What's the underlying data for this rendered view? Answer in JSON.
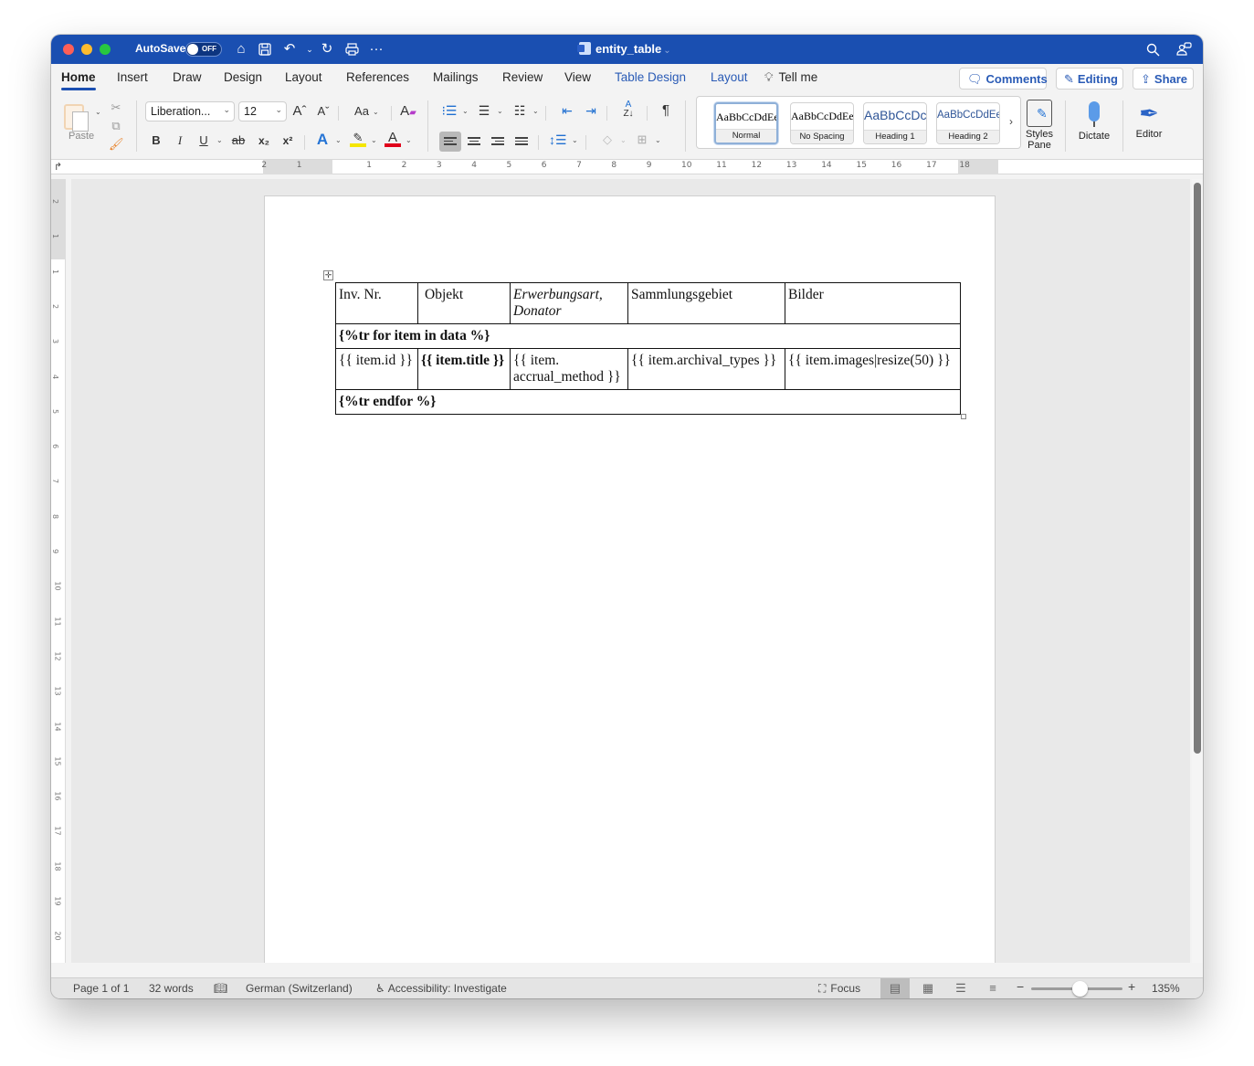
{
  "titlebar": {
    "autosave_label": "AutoSave",
    "autosave_state": "OFF",
    "doc_title": "entity_table",
    "icons": [
      "home-icon",
      "save-icon",
      "undo-icon",
      "redo-icon",
      "print-icon",
      "more-icon",
      "search-icon",
      "account-icon"
    ]
  },
  "tabs": [
    {
      "label": "Home",
      "active": true
    },
    {
      "label": "Insert"
    },
    {
      "label": "Draw"
    },
    {
      "label": "Design"
    },
    {
      "label": "Layout"
    },
    {
      "label": "References"
    },
    {
      "label": "Mailings"
    },
    {
      "label": "Review"
    },
    {
      "label": "View"
    },
    {
      "label": "Table Design",
      "contextual": true
    },
    {
      "label": "Layout",
      "contextual": true
    },
    {
      "label": "Tell me"
    }
  ],
  "ribbon_buttons": {
    "comments": "Comments",
    "editing": "Editing",
    "share": "Share"
  },
  "ribbon": {
    "paste_label": "Paste",
    "font_name": "Liberation...",
    "font_size": "12",
    "change_case": "Aa",
    "format_buttons": {
      "bold": "B",
      "italic": "I",
      "underline": "U",
      "strikethrough": "ab",
      "subscript": "x₂",
      "superscript": "x²"
    },
    "styles": [
      {
        "preview": "AaBbCcDdEe",
        "label": "Normal",
        "selected": true
      },
      {
        "preview": "AaBbCcDdEe",
        "label": "No Spacing"
      },
      {
        "preview": "AaBbCcDc",
        "label": "Heading 1"
      },
      {
        "preview": "AaBbCcDdEe",
        "label": "Heading 2"
      }
    ],
    "styles_pane_label": "Styles Pane",
    "dictate_label": "Dictate",
    "editor_label": "Editor",
    "colors": {
      "highlight": "#f5e600",
      "font_color": "#e0001b",
      "accent": "#1a4fb1"
    }
  },
  "ruler": {
    "left_numbers": [
      "2",
      "1"
    ],
    "numbers": [
      "1",
      "2",
      "3",
      "4",
      "5",
      "6",
      "7",
      "8",
      "9",
      "10",
      "11",
      "12",
      "13",
      "14",
      "15",
      "16",
      "17"
    ],
    "right_numbers": [
      "18"
    ]
  },
  "vruler": {
    "numbers": [
      "2",
      "1",
      "1",
      "2",
      "3",
      "4",
      "5",
      "6",
      "7",
      "8",
      "9",
      "10",
      "11",
      "12",
      "13",
      "14",
      "15",
      "16",
      "17",
      "18",
      "19",
      "20"
    ]
  },
  "document": {
    "table": {
      "header": [
        {
          "text": "Inv. Nr."
        },
        {
          "text": "Objekt"
        },
        {
          "text": "Erwerbungsart, Donator",
          "italic": true
        },
        {
          "text": "Sammlungsgebiet"
        },
        {
          "text": "Bilder"
        }
      ],
      "loop_start": "{%tr for item in data %}",
      "row": [
        {
          "text": "{{ item.id }}"
        },
        {
          "text": "{{ item.title }}",
          "bold_part": "item.title"
        },
        {
          "text": "{{ item. accrual_method }}"
        },
        {
          "text": "{{ item.archival_types }}"
        },
        {
          "text": "{{ item.images|resize(50) }}"
        }
      ],
      "loop_end": "{%tr endfor %}"
    }
  },
  "status": {
    "page": "Page 1 of 1",
    "words": "32 words",
    "language": "German (Switzerland)",
    "accessibility": "Accessibility: Investigate",
    "focus": "Focus",
    "zoom_percent": "135%",
    "zoom_value": 135
  }
}
